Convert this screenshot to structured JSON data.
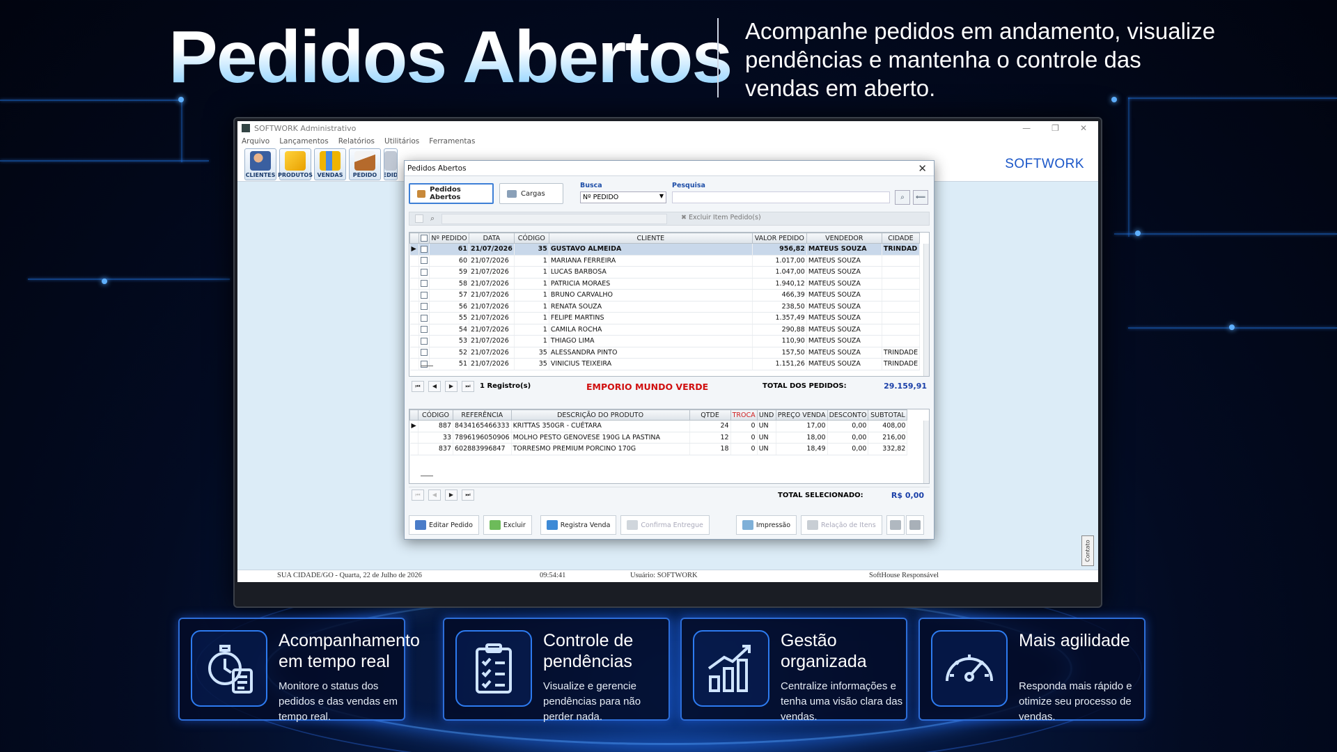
{
  "hero": {
    "title": "Pedidos Abertos",
    "subtitle": "Acompanhe pedidos em andamento, visualize pendências e mantenha o controle das vendas em aberto."
  },
  "app": {
    "window_title": "SOFTWORK Administrativo",
    "menu": [
      "Arquivo",
      "Lançamentos",
      "Relatórios",
      "Utilitários",
      "Ferramentas"
    ],
    "toolbar": [
      "CLIENTES",
      "PRODUTOS",
      "VENDAS",
      "PEDIDO",
      "PEDIDO"
    ],
    "brand": "SOFTWORK",
    "status": {
      "location_date": "SUA CIDADE/GO - Quarta, 22 de Julho de 2026",
      "time": "09:54:41",
      "user": "Usuário: SOFTWORK",
      "company": "SoftHouse Responsável"
    },
    "side_tab": "Contato"
  },
  "dialog": {
    "title": "Pedidos Abertos",
    "tabs": [
      "Pedidos Abertos",
      "Cargas"
    ],
    "busca_label": "Busca",
    "busca_value": "Nº PEDIDO",
    "pesquisa_label": "Pesquisa",
    "pesquisa_value": "",
    "excluir_item": "Excluir Item Pedido(s)",
    "orders_headers": [
      "Nº PEDIDO",
      "DATA",
      "CÓDIGO",
      "CLIENTE",
      "VALOR PEDIDO",
      "VENDEDOR",
      "CIDADE"
    ],
    "orders": [
      [
        "61",
        "21/07/2026",
        "35",
        "GUSTAVO ALMEIDA",
        "956,82",
        "MATEUS SOUZA",
        "TRINDAD"
      ],
      [
        "60",
        "21/07/2026",
        "1",
        "MARIANA FERREIRA",
        "1.017,00",
        "MATEUS SOUZA",
        ""
      ],
      [
        "59",
        "21/07/2026",
        "1",
        "LUCAS BARBOSA",
        "1.047,00",
        "MATEUS SOUZA",
        ""
      ],
      [
        "58",
        "21/07/2026",
        "1",
        "PATRICIA MORAES",
        "1.940,12",
        "MATEUS SOUZA",
        ""
      ],
      [
        "57",
        "21/07/2026",
        "1",
        "BRUNO CARVALHO",
        "466,39",
        "MATEUS SOUZA",
        ""
      ],
      [
        "56",
        "21/07/2026",
        "1",
        "RENATA SOUZA",
        "238,50",
        "MATEUS SOUZA",
        ""
      ],
      [
        "55",
        "21/07/2026",
        "1",
        "FELIPE MARTINS",
        "1.357,49",
        "MATEUS SOUZA",
        ""
      ],
      [
        "54",
        "21/07/2026",
        "1",
        "CAMILA ROCHA",
        "290,88",
        "MATEUS SOUZA",
        ""
      ],
      [
        "53",
        "21/07/2026",
        "1",
        "THIAGO LIMA",
        "110,90",
        "MATEUS SOUZA",
        ""
      ],
      [
        "52",
        "21/07/2026",
        "35",
        "ALESSANDRA PINTO",
        "157,50",
        "MATEUS SOUZA",
        "TRINDADE"
      ],
      [
        "51",
        "21/07/2026",
        "35",
        "VINICIUS TEIXEIRA",
        "1.151,26",
        "MATEUS SOUZA",
        "TRINDADE"
      ]
    ],
    "records": "1 Registro(s)",
    "client_highlight": "EMPORIO MUNDO VERDE",
    "total_label": "TOTAL DOS PEDIDOS:",
    "total_value": "29.159,91",
    "items_headers": [
      "CÓDIGO",
      "REFERÊNCIA",
      "DESCRIÇÃO DO PRODUTO",
      "QTDE",
      "TROCA",
      "UND",
      "PREÇO VENDA",
      "DESCONTO",
      "SUBTOTAL"
    ],
    "items": [
      [
        "887",
        "8434165466333",
        "KRITTAS 350GR - CUÉTARA",
        "24",
        "0",
        "UN",
        "17,00",
        "0,00",
        "408,00"
      ],
      [
        "33",
        "7896196050906",
        "MOLHO PESTO GENOVESE 190G LA PASTINA",
        "12",
        "0",
        "UN",
        "18,00",
        "0,00",
        "216,00"
      ],
      [
        "837",
        "602883996847",
        "TORRESMO PREMIUM PORCINO 170G",
        "18",
        "0",
        "UN",
        "18,49",
        "0,00",
        "332,82"
      ]
    ],
    "selected_label": "TOTAL SELECIONADO:",
    "selected_value": "R$ 0,00",
    "buttons": [
      "Editar Pedido",
      "Excluir",
      "Registra Venda",
      "Confirma Entregue",
      "Impressão",
      "Relação de Itens"
    ]
  },
  "cards": [
    {
      "title": "Acompanhamento em tempo real",
      "text": "Monitore o status dos pedidos e das vendas em tempo real.",
      "icon": "clock-clipboard-icon"
    },
    {
      "title": "Controle de pendências",
      "text": "Visualize e gerencie pendências para não perder nada.",
      "icon": "checklist-icon"
    },
    {
      "title": "Gestão organizada",
      "text": "Centralize informações e tenha uma visão clara das vendas.",
      "icon": "growth-chart-icon"
    },
    {
      "title": "Mais agilidade",
      "text": "Responda mais rápido e otimize seu processo de vendas.",
      "icon": "speedometer-icon"
    }
  ],
  "colors": {
    "accent": "#2d7bf0",
    "highlight_red": "#d01010",
    "brand_blue": "#1a56c8"
  }
}
